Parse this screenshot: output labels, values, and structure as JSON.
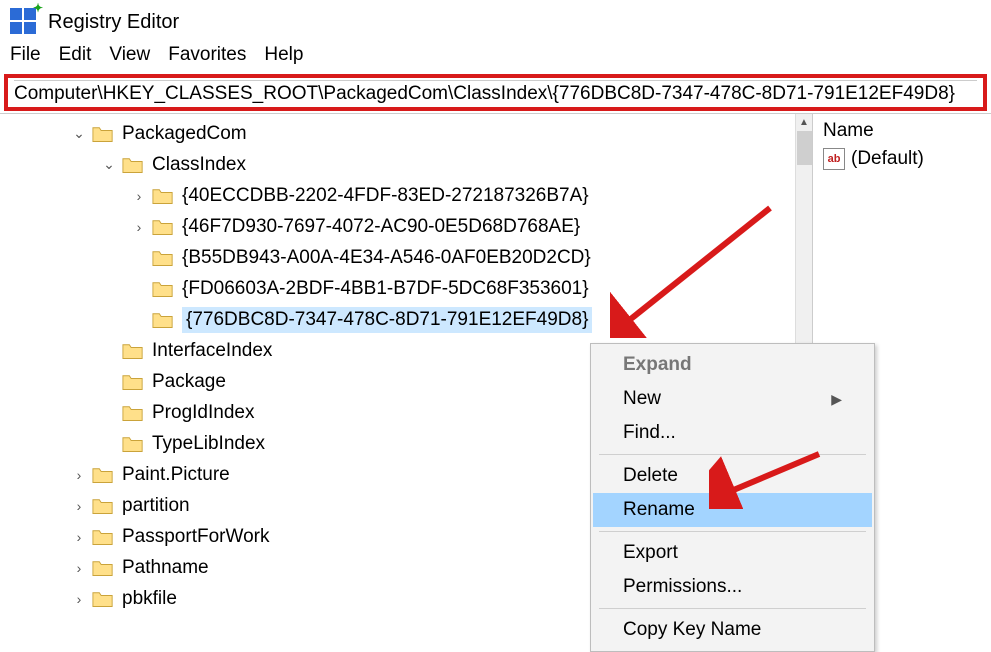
{
  "app": {
    "title": "Registry Editor"
  },
  "menu": {
    "file": "File",
    "edit": "Edit",
    "view": "View",
    "favorites": "Favorites",
    "help": "Help"
  },
  "address": "Computer\\HKEY_CLASSES_ROOT\\PackagedCom\\ClassIndex\\{776DBC8D-7347-478C-8D71-791E12EF49D8}",
  "tree": {
    "items": [
      {
        "label": "PackagedCom",
        "level": 1,
        "expander": "open",
        "selected": false
      },
      {
        "label": "ClassIndex",
        "level": 2,
        "expander": "open",
        "selected": false
      },
      {
        "label": "{40ECCDBB-2202-4FDF-83ED-272187326B7A}",
        "level": 3,
        "expander": "closed",
        "selected": false
      },
      {
        "label": "{46F7D930-7697-4072-AC90-0E5D68D768AE}",
        "level": 3,
        "expander": "closed",
        "selected": false
      },
      {
        "label": "{B55DB943-A00A-4E34-A546-0AF0EB20D2CD}",
        "level": 3,
        "expander": "none",
        "selected": false
      },
      {
        "label": "{FD06603A-2BDF-4BB1-B7DF-5DC68F353601}",
        "level": 3,
        "expander": "none",
        "selected": false
      },
      {
        "label": "{776DBC8D-7347-478C-8D71-791E12EF49D8}",
        "level": 3,
        "expander": "none",
        "selected": true
      },
      {
        "label": "InterfaceIndex",
        "level": 2,
        "expander": "none",
        "selected": false
      },
      {
        "label": "Package",
        "level": 2,
        "expander": "none",
        "selected": false
      },
      {
        "label": "ProgIdIndex",
        "level": 2,
        "expander": "none",
        "selected": false
      },
      {
        "label": "TypeLibIndex",
        "level": 2,
        "expander": "none",
        "selected": false
      },
      {
        "label": "Paint.Picture",
        "level": 1,
        "expander": "closed",
        "selected": false
      },
      {
        "label": "partition",
        "level": 1,
        "expander": "closed",
        "selected": false
      },
      {
        "label": "PassportForWork",
        "level": 1,
        "expander": "closed",
        "selected": false
      },
      {
        "label": "Pathname",
        "level": 1,
        "expander": "closed",
        "selected": false
      },
      {
        "label": "pbkfile",
        "level": 1,
        "expander": "closed",
        "selected": false
      }
    ]
  },
  "right_panel": {
    "column_header": "Name",
    "default_value_label": "(Default)"
  },
  "context_menu": {
    "expand": "Expand",
    "new": "New",
    "find": "Find...",
    "delete": "Delete",
    "rename": "Rename",
    "export": "Export",
    "permissions": "Permissions...",
    "copy_key": "Copy Key Name"
  }
}
